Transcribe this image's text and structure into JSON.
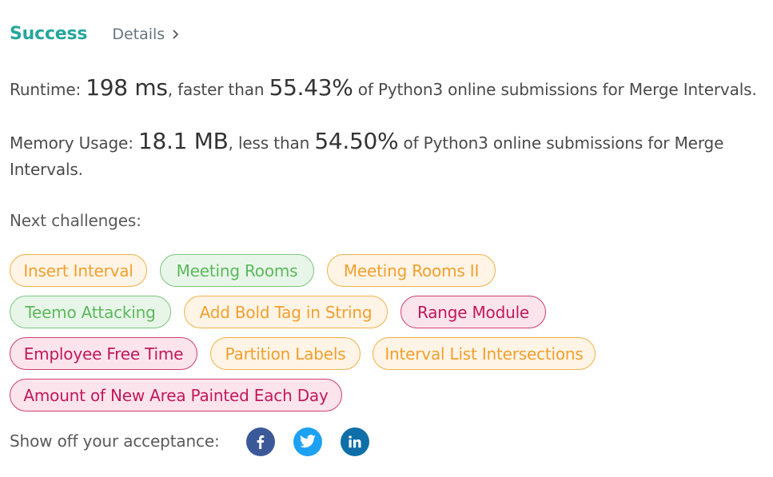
{
  "header": {
    "status": "Success",
    "details_label": "Details"
  },
  "runtime": {
    "label": "Runtime: ",
    "value": "198 ms",
    "middle": ", faster than ",
    "percent": "55.43%",
    "suffix": " of Python3 online submissions for Merge Intervals."
  },
  "memory": {
    "label": "Memory Usage: ",
    "value": "18.1 MB",
    "middle": ", less than ",
    "percent": "54.50%",
    "suffix": " of Python3 online submissions for Merge Intervals."
  },
  "next_challenges": {
    "label": "Next challenges:",
    "items": [
      {
        "label": "Insert Interval",
        "difficulty": "medium"
      },
      {
        "label": "Meeting Rooms",
        "difficulty": "easy"
      },
      {
        "label": "Meeting Rooms II",
        "difficulty": "medium"
      },
      {
        "label": "Teemo Attacking",
        "difficulty": "easy"
      },
      {
        "label": "Add Bold Tag in String",
        "difficulty": "medium"
      },
      {
        "label": "Range Module",
        "difficulty": "hard"
      },
      {
        "label": "Employee Free Time",
        "difficulty": "hard"
      },
      {
        "label": "Partition Labels",
        "difficulty": "medium"
      },
      {
        "label": "Interval List Intersections",
        "difficulty": "medium"
      },
      {
        "label": "Amount of New Area Painted Each Day",
        "difficulty": "hard"
      }
    ]
  },
  "share": {
    "label": "Show off your acceptance:",
    "icons": [
      "facebook-icon",
      "twitter-icon",
      "linkedin-icon"
    ]
  },
  "colors": {
    "success": "#26a69a",
    "easy": "#5cb85c",
    "medium": "#f0a030",
    "hard": "#c2185b"
  }
}
